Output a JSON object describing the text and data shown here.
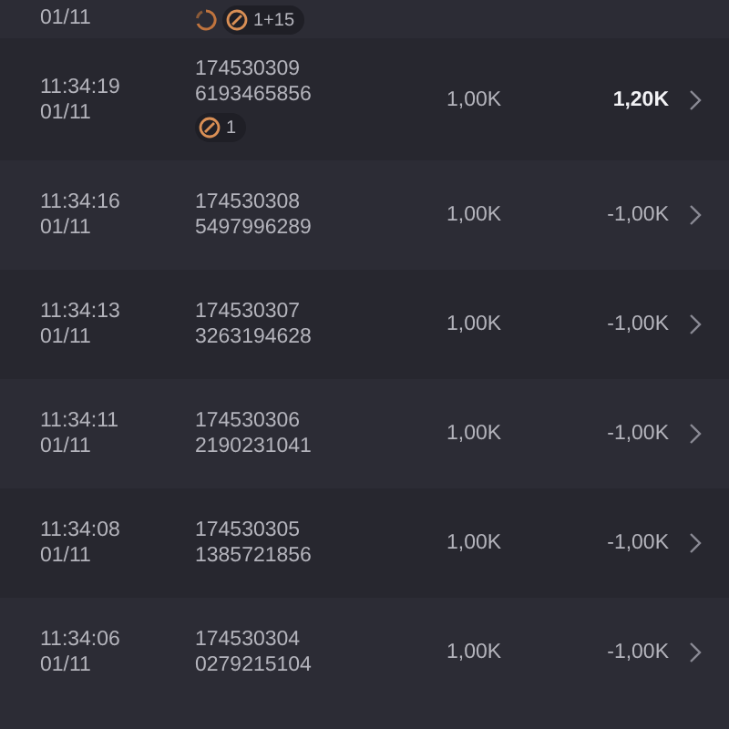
{
  "rows": [
    {
      "date": "01/11",
      "badges": [
        {
          "kind": "spinner"
        },
        {
          "kind": "ball",
          "label": "1+15"
        }
      ]
    },
    {
      "time": "11:34:19",
      "date": "01/11",
      "round": "174530309",
      "hash": "6193465856",
      "bet": "1,00K",
      "result": "1,20K",
      "won": true,
      "badges": [
        {
          "kind": "ball",
          "label": "1"
        }
      ]
    },
    {
      "time": "11:34:16",
      "date": "01/11",
      "round": "174530308",
      "hash": "5497996289",
      "bet": "1,00K",
      "result": "-1,00K",
      "won": false
    },
    {
      "time": "11:34:13",
      "date": "01/11",
      "round": "174530307",
      "hash": "3263194628",
      "bet": "1,00K",
      "result": "-1,00K",
      "won": false
    },
    {
      "time": "11:34:11",
      "date": "01/11",
      "round": "174530306",
      "hash": "2190231041",
      "bet": "1,00K",
      "result": "-1,00K",
      "won": false
    },
    {
      "time": "11:34:08",
      "date": "01/11",
      "round": "174530305",
      "hash": "1385721856",
      "bet": "1,00K",
      "result": "-1,00K",
      "won": false
    },
    {
      "time": "11:34:06",
      "date": "01/11",
      "round": "174530304",
      "hash": "0279215104",
      "bet": "1,00K",
      "result": "-1,00K",
      "won": false
    }
  ]
}
